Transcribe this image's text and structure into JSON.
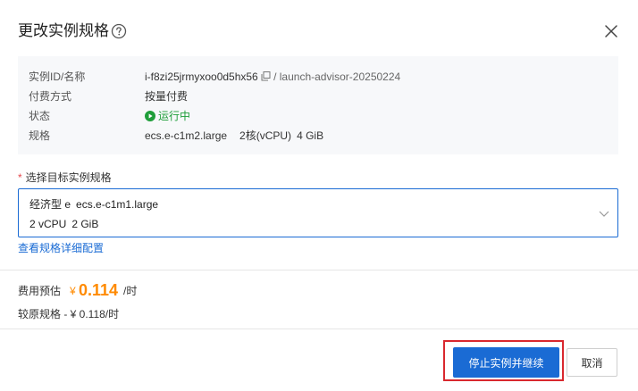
{
  "dialog": {
    "title": "更改实例规格",
    "help_icon": "help-circle-icon",
    "close_icon": "close-icon"
  },
  "info": {
    "rows": [
      {
        "label": "实例ID/名称",
        "id": "i-f8zi25jrmyxoo0d5hx56",
        "separator": "/",
        "name": "launch-advisor-20250224"
      },
      {
        "label": "付费方式",
        "value": "按量付费"
      },
      {
        "label": "状态",
        "value": "运行中"
      },
      {
        "label": "规格",
        "spec": "ecs.e-c1m2.large",
        "cpu": "2核(vCPU)",
        "mem": "4 GiB"
      }
    ]
  },
  "target": {
    "label": "选择目标实例规格",
    "required_mark": "*",
    "selected": {
      "family": "经济型 e",
      "spec": "ecs.e-c1m1.large",
      "vcpu": "2 vCPU",
      "mem": "2 GiB"
    }
  },
  "link": {
    "label": "查看规格详细配置"
  },
  "cost": {
    "label": "费用预估",
    "currency": "¥",
    "amount": "0.114",
    "unit": "/时",
    "original": "较原规格 - ¥ 0.118/时"
  },
  "footer": {
    "primary_label": "停止实例并继续",
    "cancel_label": "取消"
  },
  "colors": {
    "primary": "#1a6bd4",
    "price": "#ff8a00",
    "status_running": "#1f9e3a",
    "highlight": "#d9282e"
  }
}
